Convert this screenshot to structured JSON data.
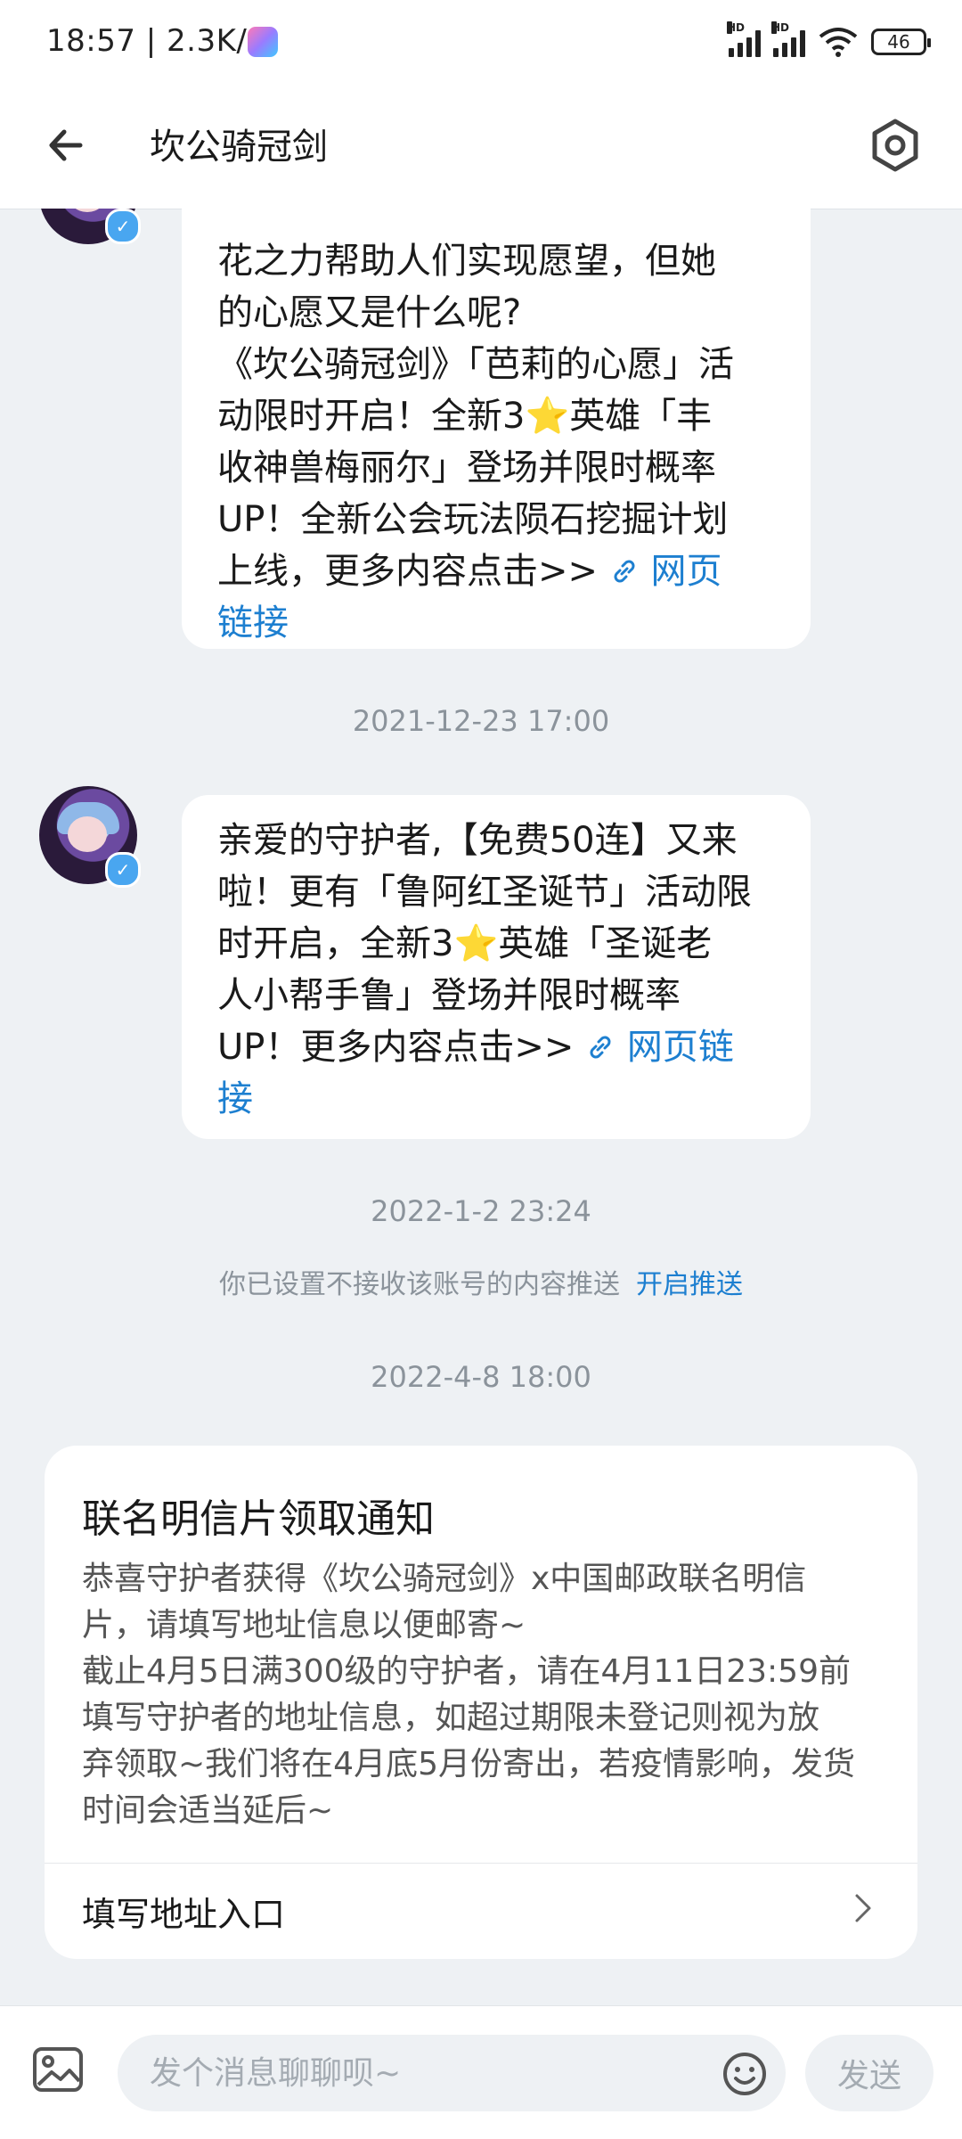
{
  "status_bar": {
    "time_speed": "18:57 | 2.3K/s",
    "hd1": "HD",
    "hd2": "HD",
    "battery": "46"
  },
  "header": {
    "title": "坎公骑冠剑"
  },
  "messages": [
    {
      "text_lines": [
        "花之力帮助人们实现愿望，但她",
        "的心愿又是什么呢?",
        "《坎公骑冠剑》「芭莉的心愿」活",
        "动限时开启！全新3⭐英雄「丰",
        "收神兽梅丽尔」登场并限时概率",
        "UP！全新公会玩法陨石挖掘计划",
        "上线，更多内容点击>> "
      ],
      "link_label_1": "网页",
      "link_label_2": "链接"
    },
    {
      "timestamp": "2021-12-23 17:00",
      "text_lines": [
        "亲爱的守护者,【免费50连】又来",
        "啦！更有「鲁阿红圣诞节」活动限",
        "时开启，全新3⭐英雄「圣诞老",
        "人小帮手鲁」登场并限时概率",
        "UP！更多内容点击>> "
      ],
      "link_label_1": "网页链",
      "link_label_2": "接"
    }
  ],
  "timestamp_2": "2022-1-2 23:24",
  "push_notice": {
    "text": "你已设置不接收该账号的内容推送",
    "action": "开启推送"
  },
  "timestamp_3": "2022-4-8 18:00",
  "card": {
    "title": "联名明信片领取通知",
    "body": "恭喜守护者获得《坎公骑冠剑》x中国邮政联名明信\n片，请填写地址信息以便邮寄~\n截止4月5日满300级的守护者，请在4月11日23:59前\n填写守护者的地址信息，如超过期限未登记则视为放\n弃领取~我们将在4月底5月份寄出，若疫情影响，发货\n时间会适当延后~",
    "footer_label": "填写地址入口"
  },
  "input_bar": {
    "placeholder": "发个消息聊聊呗~",
    "send_label": "发送"
  },
  "colors": {
    "accent": "#1d7fd0",
    "background": "#eef1f4",
    "verified": "#49a6f0"
  },
  "icons": [
    "back-arrow-icon",
    "settings-hexagon-icon",
    "link-icon",
    "verified-icon",
    "chevron-right-icon",
    "image-icon",
    "emoji-icon",
    "wifi-icon",
    "battery-icon"
  ]
}
